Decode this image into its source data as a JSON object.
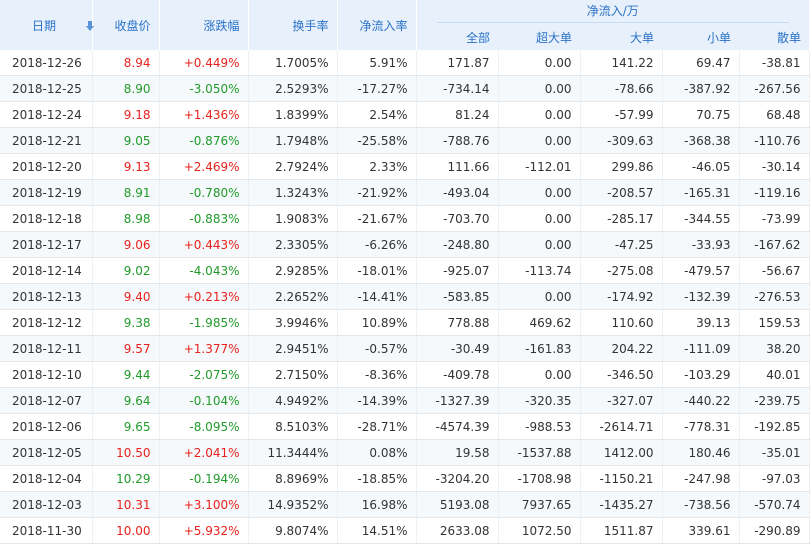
{
  "colors": {
    "up": "#e8221c",
    "down": "#209a29",
    "header_bg": "#e8f1fb",
    "header_text": "#2a72c8"
  },
  "icons": {
    "sort": "sort-down-arrow-icon"
  },
  "headers": {
    "date": "日期",
    "close": "收盘价",
    "change": "涨跌幅",
    "turnover": "换手率",
    "net_ratio": "净流入率",
    "net_group": "净流入/万",
    "total": "全部",
    "super_large": "超大单",
    "large": "大单",
    "small": "小单",
    "retail": "散单"
  },
  "rows": [
    {
      "date": "2018-12-26",
      "close": "8.94",
      "change": "+0.449%",
      "turnover": "1.7005%",
      "net_ratio": "5.91%",
      "total": "171.87",
      "super_large": "0.00",
      "large": "141.22",
      "small": "69.47",
      "retail": "-38.81",
      "dir": "up"
    },
    {
      "date": "2018-12-25",
      "close": "8.90",
      "change": "-3.050%",
      "turnover": "2.5293%",
      "net_ratio": "-17.27%",
      "total": "-734.14",
      "super_large": "0.00",
      "large": "-78.66",
      "small": "-387.92",
      "retail": "-267.56",
      "dir": "down"
    },
    {
      "date": "2018-12-24",
      "close": "9.18",
      "change": "+1.436%",
      "turnover": "1.8399%",
      "net_ratio": "2.54%",
      "total": "81.24",
      "super_large": "0.00",
      "large": "-57.99",
      "small": "70.75",
      "retail": "68.48",
      "dir": "up"
    },
    {
      "date": "2018-12-21",
      "close": "9.05",
      "change": "-0.876%",
      "turnover": "1.7948%",
      "net_ratio": "-25.58%",
      "total": "-788.76",
      "super_large": "0.00",
      "large": "-309.63",
      "small": "-368.38",
      "retail": "-110.76",
      "dir": "down"
    },
    {
      "date": "2018-12-20",
      "close": "9.13",
      "change": "+2.469%",
      "turnover": "2.7924%",
      "net_ratio": "2.33%",
      "total": "111.66",
      "super_large": "-112.01",
      "large": "299.86",
      "small": "-46.05",
      "retail": "-30.14",
      "dir": "up"
    },
    {
      "date": "2018-12-19",
      "close": "8.91",
      "change": "-0.780%",
      "turnover": "1.3243%",
      "net_ratio": "-21.92%",
      "total": "-493.04",
      "super_large": "0.00",
      "large": "-208.57",
      "small": "-165.31",
      "retail": "-119.16",
      "dir": "down"
    },
    {
      "date": "2018-12-18",
      "close": "8.98",
      "change": "-0.883%",
      "turnover": "1.9083%",
      "net_ratio": "-21.67%",
      "total": "-703.70",
      "super_large": "0.00",
      "large": "-285.17",
      "small": "-344.55",
      "retail": "-73.99",
      "dir": "down"
    },
    {
      "date": "2018-12-17",
      "close": "9.06",
      "change": "+0.443%",
      "turnover": "2.3305%",
      "net_ratio": "-6.26%",
      "total": "-248.80",
      "super_large": "0.00",
      "large": "-47.25",
      "small": "-33.93",
      "retail": "-167.62",
      "dir": "up"
    },
    {
      "date": "2018-12-14",
      "close": "9.02",
      "change": "-4.043%",
      "turnover": "2.9285%",
      "net_ratio": "-18.01%",
      "total": "-925.07",
      "super_large": "-113.74",
      "large": "-275.08",
      "small": "-479.57",
      "retail": "-56.67",
      "dir": "down"
    },
    {
      "date": "2018-12-13",
      "close": "9.40",
      "change": "+0.213%",
      "turnover": "2.2652%",
      "net_ratio": "-14.41%",
      "total": "-583.85",
      "super_large": "0.00",
      "large": "-174.92",
      "small": "-132.39",
      "retail": "-276.53",
      "dir": "up"
    },
    {
      "date": "2018-12-12",
      "close": "9.38",
      "change": "-1.985%",
      "turnover": "3.9946%",
      "net_ratio": "10.89%",
      "total": "778.88",
      "super_large": "469.62",
      "large": "110.60",
      "small": "39.13",
      "retail": "159.53",
      "dir": "down"
    },
    {
      "date": "2018-12-11",
      "close": "9.57",
      "change": "+1.377%",
      "turnover": "2.9451%",
      "net_ratio": "-0.57%",
      "total": "-30.49",
      "super_large": "-161.83",
      "large": "204.22",
      "small": "-111.09",
      "retail": "38.20",
      "dir": "up"
    },
    {
      "date": "2018-12-10",
      "close": "9.44",
      "change": "-2.075%",
      "turnover": "2.7150%",
      "net_ratio": "-8.36%",
      "total": "-409.78",
      "super_large": "0.00",
      "large": "-346.50",
      "small": "-103.29",
      "retail": "40.01",
      "dir": "down"
    },
    {
      "date": "2018-12-07",
      "close": "9.64",
      "change": "-0.104%",
      "turnover": "4.9492%",
      "net_ratio": "-14.39%",
      "total": "-1327.39",
      "super_large": "-320.35",
      "large": "-327.07",
      "small": "-440.22",
      "retail": "-239.75",
      "dir": "down"
    },
    {
      "date": "2018-12-06",
      "close": "9.65",
      "change": "-8.095%",
      "turnover": "8.5103%",
      "net_ratio": "-28.71%",
      "total": "-4574.39",
      "super_large": "-988.53",
      "large": "-2614.71",
      "small": "-778.31",
      "retail": "-192.85",
      "dir": "down"
    },
    {
      "date": "2018-12-05",
      "close": "10.50",
      "change": "+2.041%",
      "turnover": "11.3444%",
      "net_ratio": "0.08%",
      "total": "19.58",
      "super_large": "-1537.88",
      "large": "1412.00",
      "small": "180.46",
      "retail": "-35.01",
      "dir": "up"
    },
    {
      "date": "2018-12-04",
      "close": "10.29",
      "change": "-0.194%",
      "turnover": "8.8969%",
      "net_ratio": "-18.85%",
      "total": "-3204.20",
      "super_large": "-1708.98",
      "large": "-1150.21",
      "small": "-247.98",
      "retail": "-97.03",
      "dir": "down"
    },
    {
      "date": "2018-12-03",
      "close": "10.31",
      "change": "+3.100%",
      "turnover": "14.9352%",
      "net_ratio": "16.98%",
      "total": "5193.08",
      "super_large": "7937.65",
      "large": "-1435.27",
      "small": "-738.56",
      "retail": "-570.74",
      "dir": "up"
    },
    {
      "date": "2018-11-30",
      "close": "10.00",
      "change": "+5.932%",
      "turnover": "9.8074%",
      "net_ratio": "14.51%",
      "total": "2633.08",
      "super_large": "1072.50",
      "large": "1511.87",
      "small": "339.61",
      "retail": "-290.89",
      "dir": "up"
    }
  ]
}
